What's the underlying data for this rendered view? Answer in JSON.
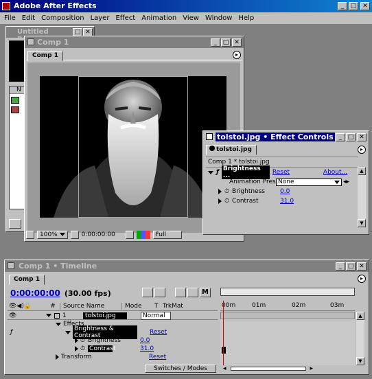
{
  "app": {
    "title": "Adobe After Effects"
  },
  "menu": [
    "File",
    "Edit",
    "Composition",
    "Layer",
    "Effect",
    "Animation",
    "View",
    "Window",
    "Help"
  ],
  "project": {
    "title": "Untitled Project.aep *",
    "col_header": "N"
  },
  "comp_window": {
    "title": "Comp 1",
    "tab": "Comp 1",
    "zoom": "100%",
    "timecode": "0:00:00:00",
    "resolution": "Full"
  },
  "effect_controls": {
    "title_file": "tolstoi.jpg",
    "title_rest": "Effect Controls",
    "tab": "tolstoi.jpg",
    "breadcrumb": "Comp 1 * tolstoi.jpg",
    "effect_name": "Brightness ...",
    "reset": "Reset",
    "about": "About...",
    "animation_label": "Animation Pres",
    "animation_value": "None",
    "params": [
      {
        "label": "Brightness",
        "value": "0.0"
      },
      {
        "label": "Contrast",
        "value": "31.0"
      }
    ]
  },
  "timeline": {
    "title": "Comp 1 • Timeline",
    "tab": "Comp 1",
    "timecode": "0:00:00:00",
    "fps": "(30.00 fps)",
    "columns": {
      "num": "#",
      "source": "Source Name",
      "mode": "Mode",
      "t": "T",
      "trkmat": "TrkMat"
    },
    "ruler": [
      "00m",
      "01m",
      "02m",
      "03m"
    ],
    "layer": {
      "num": "1",
      "name": "tolstoi.jpg",
      "mode": "Normal"
    },
    "rows": {
      "effects": "Effects",
      "effect": "Brightness & Contrast",
      "brightness": "Brightness",
      "contrast": "Contrast",
      "transform": "Transform",
      "reset1": "Reset",
      "val_brightness": "0.0",
      "val_contrast": "31.0",
      "reset2": "Reset"
    },
    "footer": "Switches / Modes"
  }
}
